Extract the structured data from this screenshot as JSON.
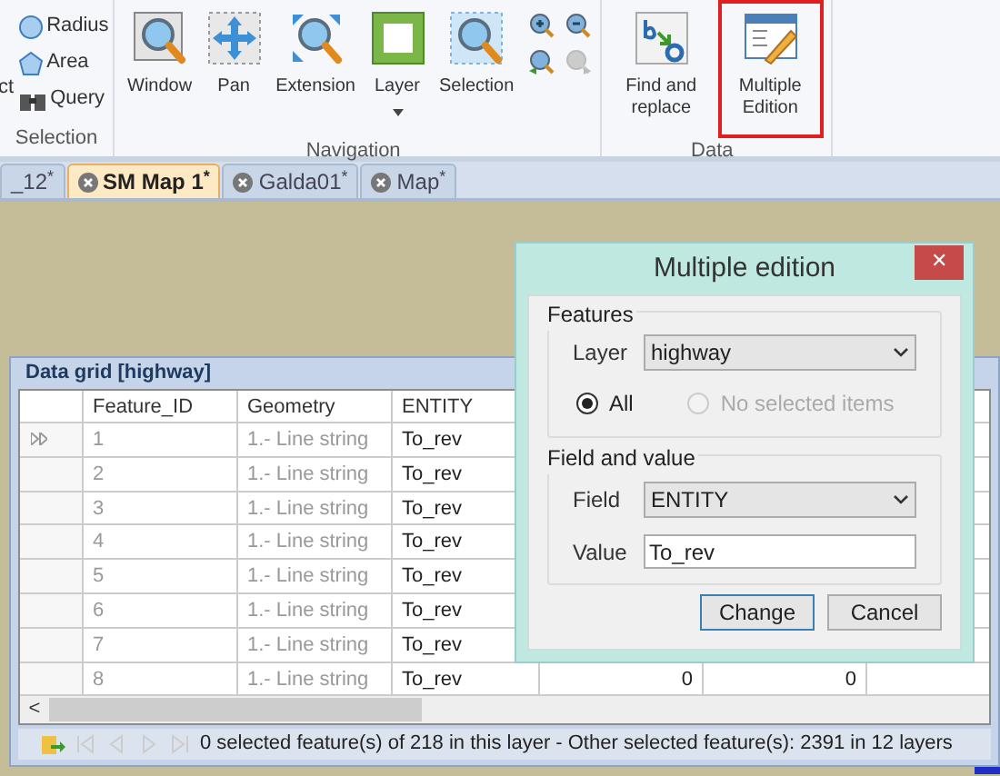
{
  "ribbon": {
    "groups": [
      {
        "label": "Selection",
        "cut_label": "ct",
        "small": [
          {
            "kind": "circle",
            "label": "Radius"
          },
          {
            "kind": "pentagon",
            "label": "Area"
          },
          {
            "kind": "binoculars",
            "label": "Query"
          }
        ]
      },
      {
        "label": "Navigation",
        "large": [
          {
            "kind": "window",
            "label": "Window",
            "dropdown": false,
            "selected": false
          },
          {
            "kind": "pan",
            "label": "Pan",
            "dropdown": false,
            "selected": false
          },
          {
            "kind": "extent",
            "label": "Extension",
            "dropdown": false,
            "selected": false
          },
          {
            "kind": "layer",
            "label": "Layer",
            "dropdown": true,
            "selected": false
          },
          {
            "kind": "selection",
            "label": "Selection",
            "dropdown": false,
            "selected": false
          }
        ],
        "zoom_icons": [
          {
            "kind": "zoom-in",
            "disabled": false
          },
          {
            "kind": "zoom-out",
            "disabled": false
          },
          {
            "kind": "zoom-back",
            "disabled": false
          },
          {
            "kind": "zoom-next",
            "disabled": true
          }
        ]
      },
      {
        "label": "Data",
        "large": [
          {
            "kind": "replace",
            "label": "Find and replace",
            "dropdown": false,
            "selected": false
          },
          {
            "kind": "edit",
            "label": "Multiple Edition",
            "dropdown": false,
            "selected": true
          }
        ]
      }
    ]
  },
  "tabs": [
    {
      "label": "_12$^{*}$",
      "closable": false,
      "selected": false
    },
    {
      "label": "SM Map 1$^{*}$",
      "closable": true,
      "selected": true
    },
    {
      "label": "Galda01$^{*}$",
      "closable": true,
      "selected": false
    },
    {
      "label": "Map$^{*}$",
      "closable": true,
      "selected": false
    }
  ],
  "data_grid": {
    "title": "Data grid [highway]",
    "columns": [
      "Feature_ID",
      "Geometry",
      "ENTITY"
    ],
    "rows": [
      {
        "current": true,
        "cells": [
          "1",
          "1.- Line string",
          "To_rev"
        ]
      },
      {
        "current": false,
        "cells": [
          "2",
          "1.- Line string",
          "To_rev"
        ]
      },
      {
        "current": false,
        "cells": [
          "3",
          "1.- Line string",
          "To_rev"
        ]
      },
      {
        "current": false,
        "cells": [
          "4",
          "1.- Line string",
          "To_rev"
        ]
      },
      {
        "current": false,
        "cells": [
          "5",
          "1.- Line string",
          "To_rev"
        ]
      },
      {
        "current": false,
        "cells": [
          "6",
          "1.- Line string",
          "To_rev"
        ]
      },
      {
        "current": false,
        "cells": [
          "7",
          "1.- Line string",
          "To_rev"
        ]
      },
      {
        "current": false,
        "cells": [
          "8",
          "1.- Line string",
          "To_rev",
          "0",
          "0"
        ]
      }
    ],
    "scroll_left": "<",
    "status": "0 selected feature(s) of 218 in this layer - Other selected feature(s): 2391 in 12 layers"
  },
  "dialog": {
    "title": "Multiple edition",
    "close": "✕",
    "features": {
      "legend": "Features",
      "layer_label": "Layer",
      "layer_value": "highway",
      "radios": [
        {
          "label": "All",
          "selected": true,
          "disabled": false
        },
        {
          "label": "No selected items",
          "selected": false,
          "disabled": true
        }
      ]
    },
    "field_value": {
      "legend": "Field and value",
      "field_label": "Field",
      "field_value": "ENTITY",
      "value_label": "Value",
      "value": "To_rev"
    },
    "buttons": [
      {
        "label": "Change",
        "default": true
      },
      {
        "label": "Cancel",
        "default": false
      }
    ]
  }
}
